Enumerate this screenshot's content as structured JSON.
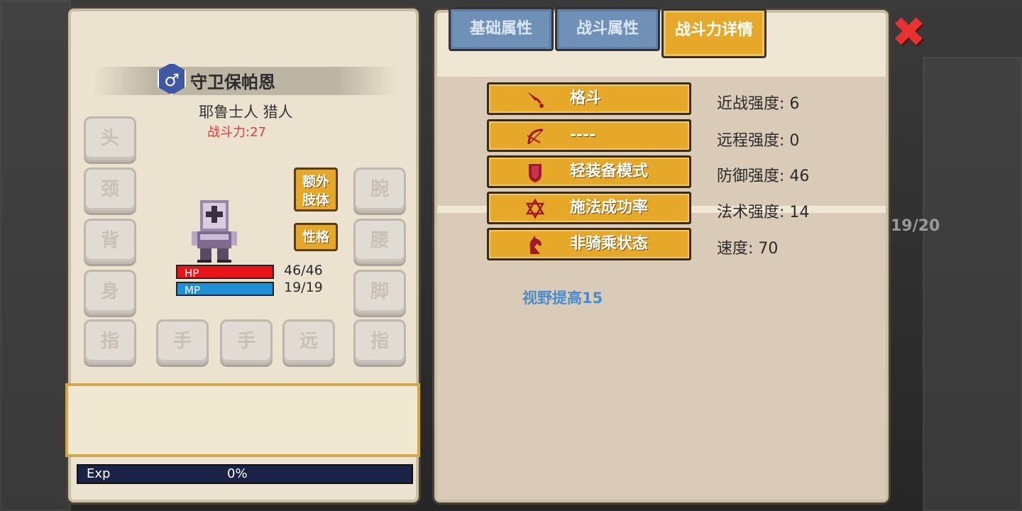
{
  "character": {
    "gender_symbol": "♂",
    "name": "守卫保帕恩",
    "race_class": "耶鲁士人 猎人",
    "power": "战斗力:27",
    "hp_label": "HP",
    "hp_value": "46/46",
    "hp_fraction": 1.0,
    "mp_label": "MP",
    "mp_value": "19/19",
    "mp_fraction": 1.0
  },
  "equipment_slots": {
    "head": "头",
    "neck": "颈",
    "back": "背",
    "body": "身",
    "finger_left": "指",
    "hand_1": "手",
    "hand_2": "手",
    "ranged": "远",
    "finger_right": "指",
    "wrist": "腕",
    "waist": "腰",
    "feet": "脚"
  },
  "side_buttons": {
    "extra_limbs": "额外肢体",
    "extra_limbs_line1": "额外",
    "extra_limbs_line2": "肢体",
    "personality": "性格"
  },
  "exp": {
    "label": "Exp",
    "value": "0%",
    "fraction": 0
  },
  "tabs": [
    {
      "label": "基础属性",
      "active": false
    },
    {
      "label": "战斗属性",
      "active": false
    },
    {
      "label": "战斗力详情",
      "active": true
    }
  ],
  "combat_rows": [
    {
      "icon": "sword-icon",
      "label": "格斗",
      "stat": "近战强度: 6"
    },
    {
      "icon": "bow-icon",
      "label": "----",
      "stat": "远程强度: 0"
    },
    {
      "icon": "shield-icon",
      "label": "轻装备模式",
      "stat": "防御强度: 46"
    },
    {
      "icon": "hexagram-icon",
      "label": "施法成功率",
      "stat": "法术强度: 14"
    },
    {
      "icon": "horse-icon",
      "label": "非骑乘状态",
      "stat": "速度: 70"
    }
  ],
  "bonus_text": "视野提高15",
  "background": {
    "counter": "19/20"
  },
  "colors": {
    "accent_gold": "#e5a829",
    "tab_blue": "#6f90b7",
    "hp_red": "#e8141a",
    "mp_blue": "#1f8fd6",
    "power_red": "#e23a3a",
    "bonus_blue": "#4a8ccf",
    "icon_crimson": "#a0182c"
  }
}
